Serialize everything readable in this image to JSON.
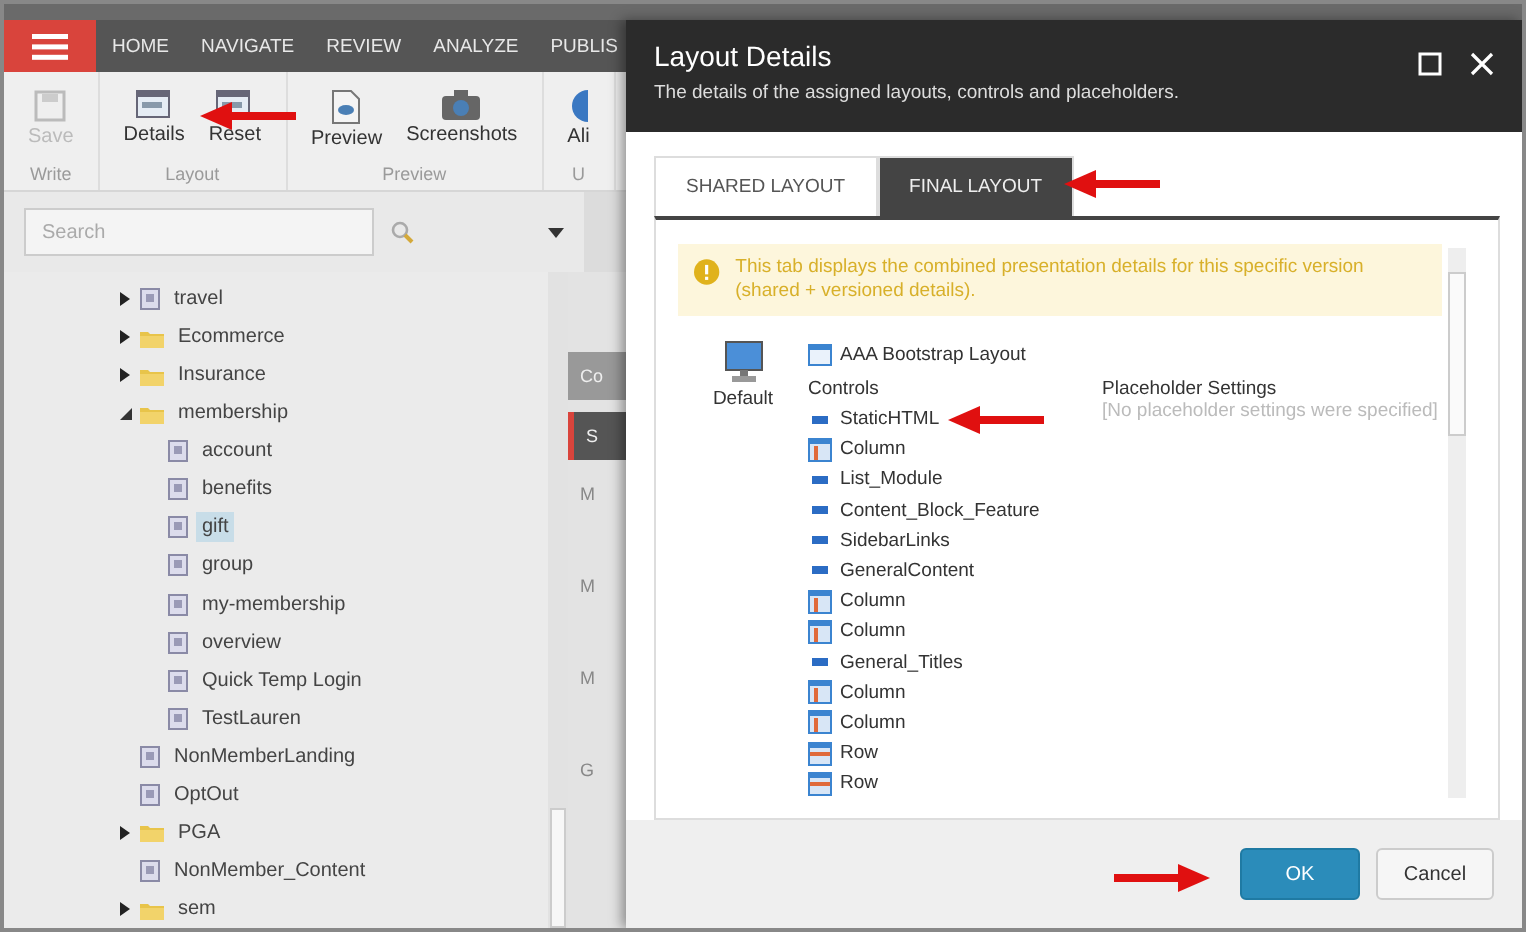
{
  "nav": {
    "tabs": [
      {
        "label": "HOME",
        "selected": false
      },
      {
        "label": "NAVIGATE",
        "selected": false
      },
      {
        "label": "REVIEW",
        "selected": false
      },
      {
        "label": "ANALYZE",
        "selected": false
      },
      {
        "label": "PUBLIS",
        "selected": false
      }
    ]
  },
  "ribbon": {
    "groups": [
      {
        "label": "Write",
        "buttons": [
          {
            "label": "Save",
            "disabled": true
          }
        ]
      },
      {
        "label": "Layout",
        "buttons": [
          {
            "label": "Details",
            "disabled": false
          },
          {
            "label": "Reset",
            "disabled": false
          }
        ]
      },
      {
        "label": "Preview",
        "buttons": [
          {
            "label": "Preview",
            "disabled": false
          },
          {
            "label": "Screenshots",
            "disabled": false
          }
        ]
      },
      {
        "label": "U",
        "buttons": [
          {
            "label": "Ali",
            "disabled": false
          }
        ]
      }
    ]
  },
  "search": {
    "placeholder": "Search"
  },
  "tree": [
    {
      "label": "travel",
      "kind": "page",
      "expandable": true,
      "expanded": false,
      "selected": false
    },
    {
      "label": "Ecommerce",
      "kind": "folder",
      "expandable": true,
      "expanded": false,
      "selected": false
    },
    {
      "label": "Insurance",
      "kind": "folder",
      "expandable": true,
      "expanded": false,
      "selected": false
    },
    {
      "label": "membership",
      "kind": "folder",
      "expandable": true,
      "expanded": true,
      "selected": false,
      "children": [
        {
          "label": "account",
          "kind": "page",
          "expandable": false,
          "selected": false
        },
        {
          "label": "benefits",
          "kind": "page",
          "expandable": false,
          "selected": false
        },
        {
          "label": "gift",
          "kind": "page",
          "expandable": false,
          "selected": true
        },
        {
          "label": "group",
          "kind": "page",
          "expandable": false,
          "selected": false
        },
        {
          "label": "my-membership",
          "kind": "page",
          "expandable": false,
          "selected": false
        },
        {
          "label": "overview",
          "kind": "page",
          "expandable": false,
          "selected": false
        },
        {
          "label": "Quick Temp Login",
          "kind": "page",
          "expandable": false,
          "selected": false
        },
        {
          "label": "TestLauren",
          "kind": "page",
          "expandable": false,
          "selected": false
        }
      ]
    },
    {
      "label": "NonMemberLanding",
      "kind": "page",
      "expandable": false,
      "selected": false
    },
    {
      "label": "OptOut",
      "kind": "page",
      "expandable": false,
      "selected": false
    },
    {
      "label": "PGA",
      "kind": "folder",
      "expandable": true,
      "expanded": false,
      "selected": false
    },
    {
      "label": "NonMember_Content",
      "kind": "page",
      "expandable": false,
      "selected": false
    },
    {
      "label": "sem",
      "kind": "folder",
      "expandable": true,
      "expanded": false,
      "selected": false
    }
  ],
  "background_panel": {
    "section_labels": [
      "Co",
      "S"
    ],
    "field_labels": [
      "M",
      "M",
      "M",
      "G"
    ]
  },
  "dialog": {
    "title": "Layout Details",
    "subtitle": "The details of the assigned layouts, controls and placeholders.",
    "tabs": [
      {
        "label": "SHARED LAYOUT",
        "selected": false
      },
      {
        "label": "FINAL LAYOUT",
        "selected": true
      }
    ],
    "notice": "This tab displays the combined presentation details for this specific version (shared + versioned details).",
    "device": "Default",
    "layout": "AAA Bootstrap Layout",
    "controls_heading": "Controls",
    "controls": [
      {
        "name": "StaticHTML",
        "kind": "rendering"
      },
      {
        "name": "Column",
        "kind": "column"
      },
      {
        "name": "List_Module",
        "kind": "rendering"
      },
      {
        "name": "Content_Block_Feature",
        "kind": "rendering"
      },
      {
        "name": "SidebarLinks",
        "kind": "rendering"
      },
      {
        "name": "GeneralContent",
        "kind": "rendering"
      },
      {
        "name": "Column",
        "kind": "column"
      },
      {
        "name": "Column",
        "kind": "column"
      },
      {
        "name": "General_Titles",
        "kind": "rendering"
      },
      {
        "name": "Column",
        "kind": "column"
      },
      {
        "name": "Column",
        "kind": "column"
      },
      {
        "name": "Row",
        "kind": "row"
      },
      {
        "name": "Row",
        "kind": "row"
      }
    ],
    "placeholder_heading": "Placeholder Settings",
    "placeholder_note": "[No placeholder settings were specified]",
    "buttons": [
      {
        "label": "OK",
        "primary": true
      },
      {
        "label": "Cancel",
        "primary": false
      }
    ]
  }
}
